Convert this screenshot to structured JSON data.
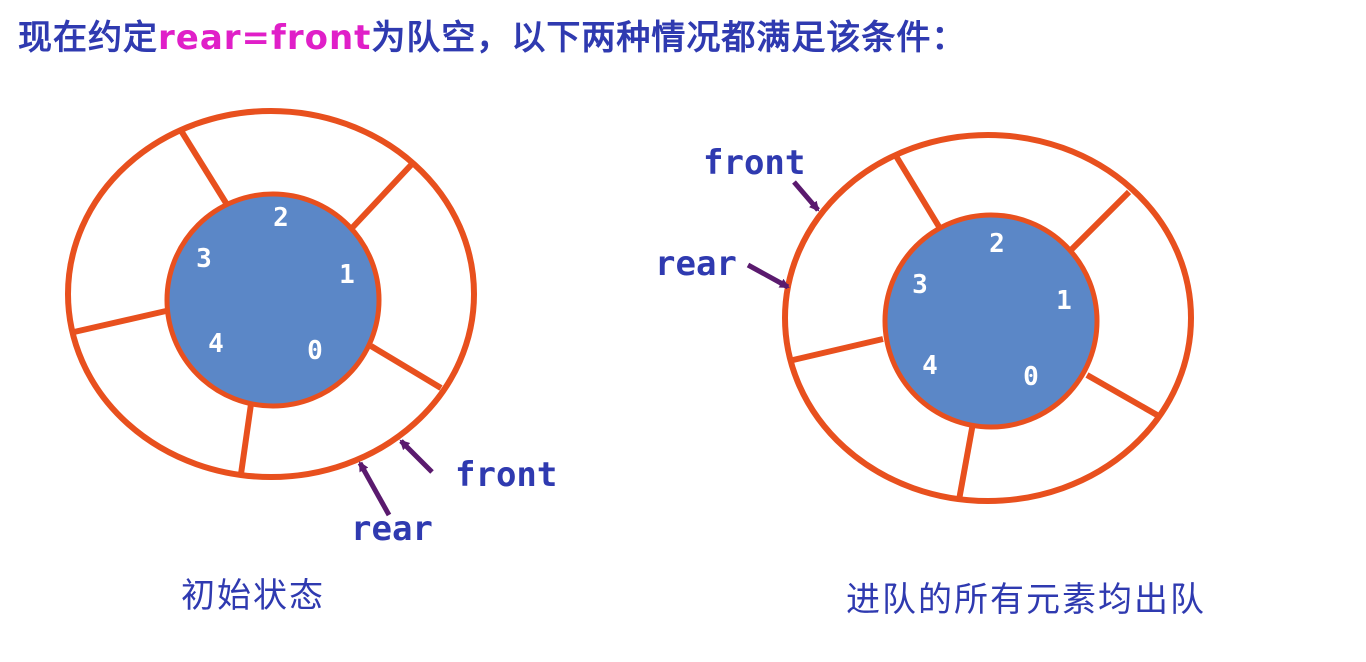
{
  "title": {
    "prefix": "现在约定",
    "highlight": "rear=front",
    "suffix": "为队空，以下两种情况都满足该条件："
  },
  "colors": {
    "ring": "#e8501e",
    "hub": "#5b87c7",
    "arrow": "#5a1a6e",
    "text": "#2f3ab0",
    "highlight": "#e01fc8"
  },
  "diagrams": [
    {
      "slots": [
        "0",
        "1",
        "2",
        "3",
        "4"
      ],
      "pointers": [
        {
          "label": "front"
        },
        {
          "label": "rear"
        }
      ],
      "caption": "初始状态"
    },
    {
      "slots": [
        "0",
        "1",
        "2",
        "3",
        "4"
      ],
      "pointers": [
        {
          "label": "front"
        },
        {
          "label": "rear"
        }
      ],
      "caption": "进队的所有元素均出队"
    }
  ]
}
